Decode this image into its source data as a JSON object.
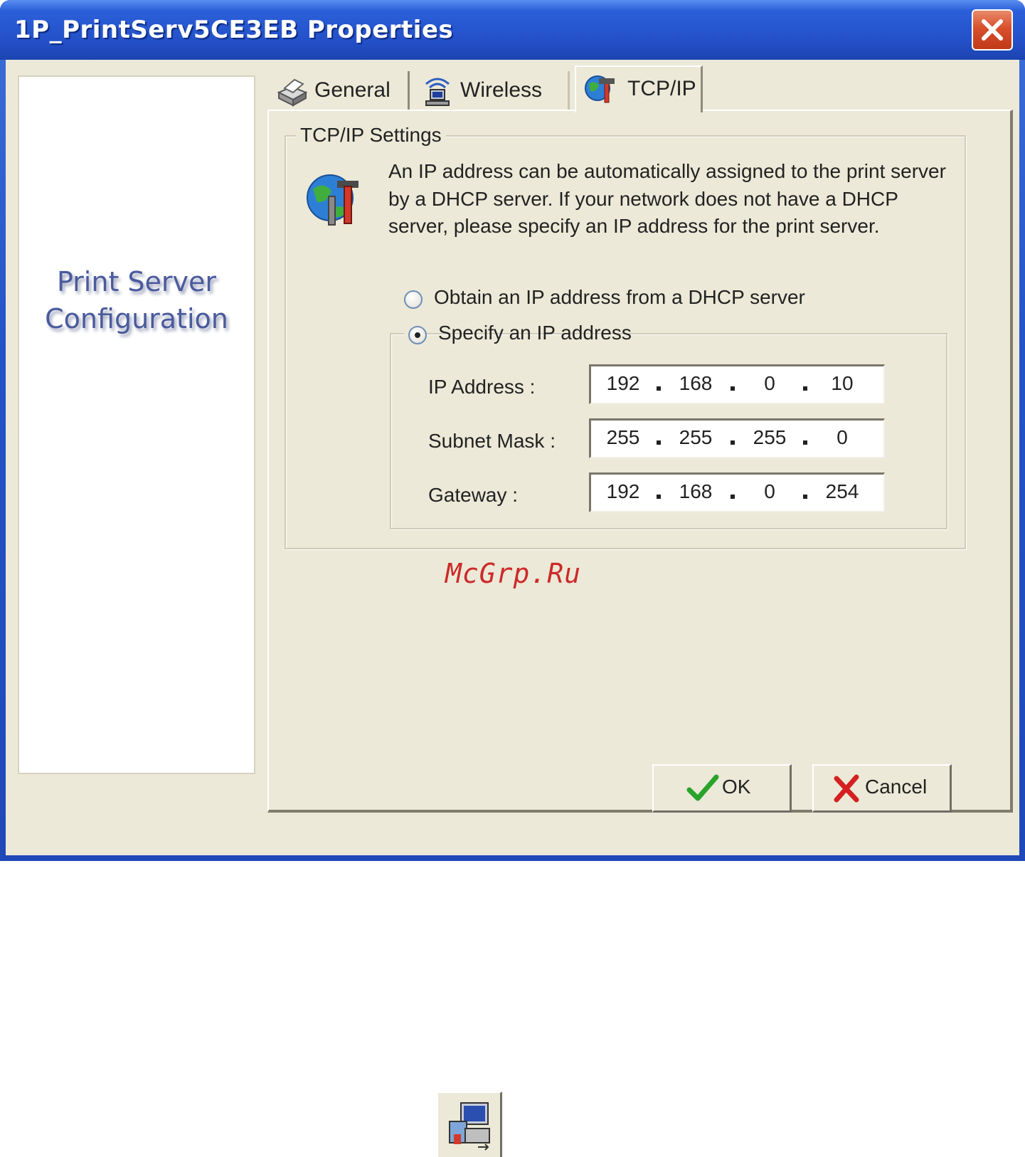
{
  "window": {
    "title": "1P_PrintServ5CE3EB Properties"
  },
  "banner": {
    "line1": "Print Server",
    "line2": "Configuration"
  },
  "tabs": [
    {
      "label": "General",
      "icon": "printer-icon",
      "selected": false
    },
    {
      "label": "Wireless",
      "icon": "wireless-icon",
      "selected": false
    },
    {
      "label": "TCP/IP",
      "icon": "network-tools-icon",
      "selected": true
    }
  ],
  "tcpip": {
    "group_title": "TCP/IP Settings",
    "description": "An IP address can be automatically assigned to the print server by a DHCP server. If your network does not have a DHCP server, please specify an IP address for the print server.",
    "option_dhcp": {
      "label": "Obtain an IP address from a DHCP server",
      "selected": false
    },
    "option_static": {
      "label": "Specify an IP address",
      "selected": true
    },
    "fields": {
      "ip": {
        "label": "IP Address :",
        "octets": [
          "192",
          "168",
          "0",
          "10"
        ]
      },
      "subnet": {
        "label": "Subnet Mask :",
        "octets": [
          "255",
          "255",
          "255",
          "0"
        ]
      },
      "gateway": {
        "label": "Gateway :",
        "octets": [
          "192",
          "168",
          "0",
          "254"
        ]
      }
    }
  },
  "buttons": {
    "ok": "OK",
    "cancel": "Cancel"
  },
  "watermark": "McGrp.Ru",
  "colors": {
    "titlebar": "#2453c8",
    "dialog_bg": "#ece9d8",
    "banner_text": "#4a5a9c",
    "watermark": "#cc2a2a"
  }
}
